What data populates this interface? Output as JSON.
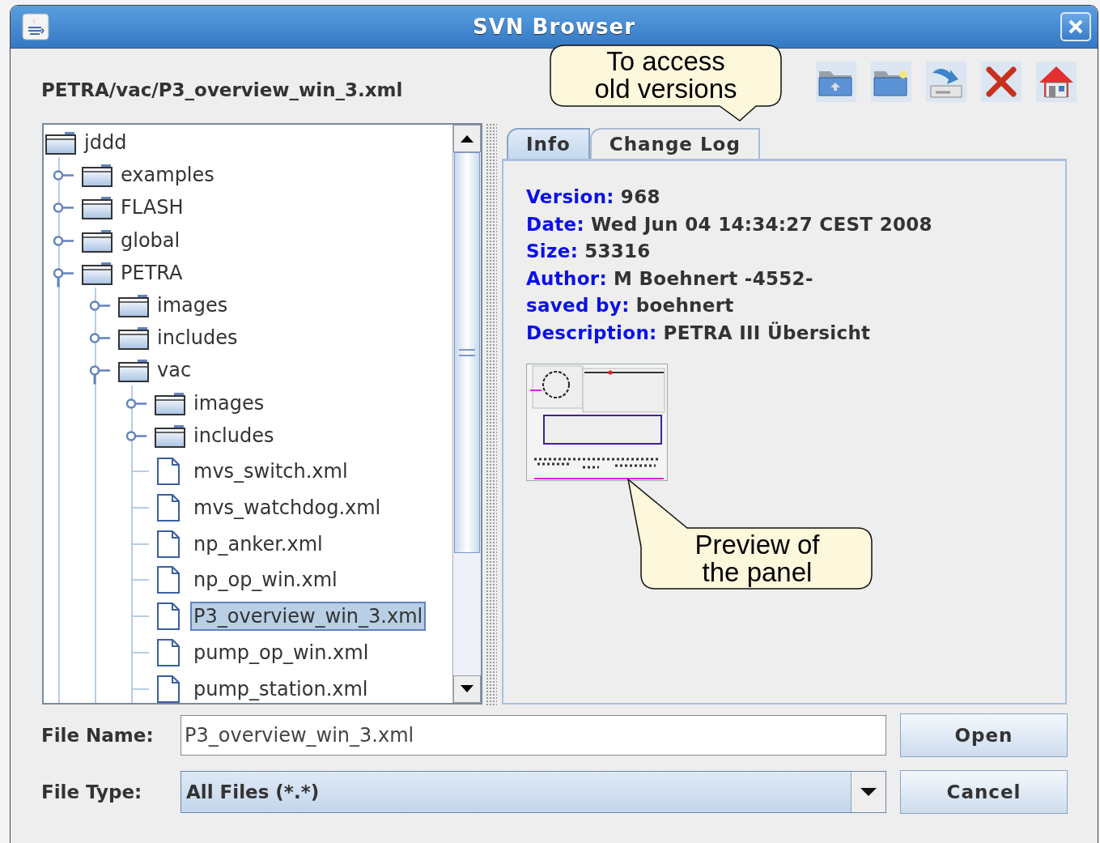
{
  "window": {
    "title": "SVN Browser"
  },
  "path": "PETRA/vac/P3_overview_win_3.xml",
  "tree": {
    "label": "jddd",
    "kind": "folder",
    "selected": false,
    "children": [
      {
        "label": "examples",
        "kind": "folder",
        "expanded": false,
        "selected": false
      },
      {
        "label": "FLASH",
        "kind": "folder",
        "expanded": false,
        "selected": false
      },
      {
        "label": "global",
        "kind": "folder",
        "expanded": false,
        "selected": false
      },
      {
        "label": "PETRA",
        "kind": "folder",
        "expanded": true,
        "selected": false,
        "children": [
          {
            "label": "images",
            "kind": "folder",
            "expanded": false,
            "selected": false
          },
          {
            "label": "includes",
            "kind": "folder",
            "expanded": false,
            "selected": false
          },
          {
            "label": "vac",
            "kind": "folder",
            "expanded": true,
            "selected": false,
            "children": [
              {
                "label": "images",
                "kind": "folder",
                "expanded": false,
                "selected": false
              },
              {
                "label": "includes",
                "kind": "folder",
                "expanded": false,
                "selected": false
              },
              {
                "label": "mvs_switch.xml",
                "kind": "file",
                "selected": false
              },
              {
                "label": "mvs_watchdog.xml",
                "kind": "file",
                "selected": false
              },
              {
                "label": "np_anker.xml",
                "kind": "file",
                "selected": false
              },
              {
                "label": "np_op_win.xml",
                "kind": "file",
                "selected": false
              },
              {
                "label": "P3_overview_win_3.xml",
                "kind": "file",
                "selected": true
              },
              {
                "label": "pump_op_win.xml",
                "kind": "file",
                "selected": false
              },
              {
                "label": "pump_station.xml",
                "kind": "file",
                "selected": false
              }
            ]
          }
        ]
      }
    ]
  },
  "tabs": [
    {
      "label": "Info",
      "selected": true
    },
    {
      "label": "Change Log",
      "selected": false
    }
  ],
  "info": [
    {
      "label": "Version:",
      "value": "968"
    },
    {
      "label": "Date:",
      "value": "Wed Jun 04 14:34:27 CEST 2008"
    },
    {
      "label": "Size:",
      "value": "53316"
    },
    {
      "label": "Author:",
      "value": "M Boehnert -4552-"
    },
    {
      "label": "saved by:",
      "value": "boehnert"
    },
    {
      "label": "Description:",
      "value": "PETRA III Übersicht"
    }
  ],
  "file_name": {
    "label": "File Name:",
    "value": "P3_overview_win_3.xml"
  },
  "file_type": {
    "label": "File Type:",
    "value": "All Files (*.*)"
  },
  "buttons": [
    "Open",
    "Cancel"
  ],
  "callouts": [
    "To access\nold versions",
    "Preview of\nthe panel"
  ]
}
